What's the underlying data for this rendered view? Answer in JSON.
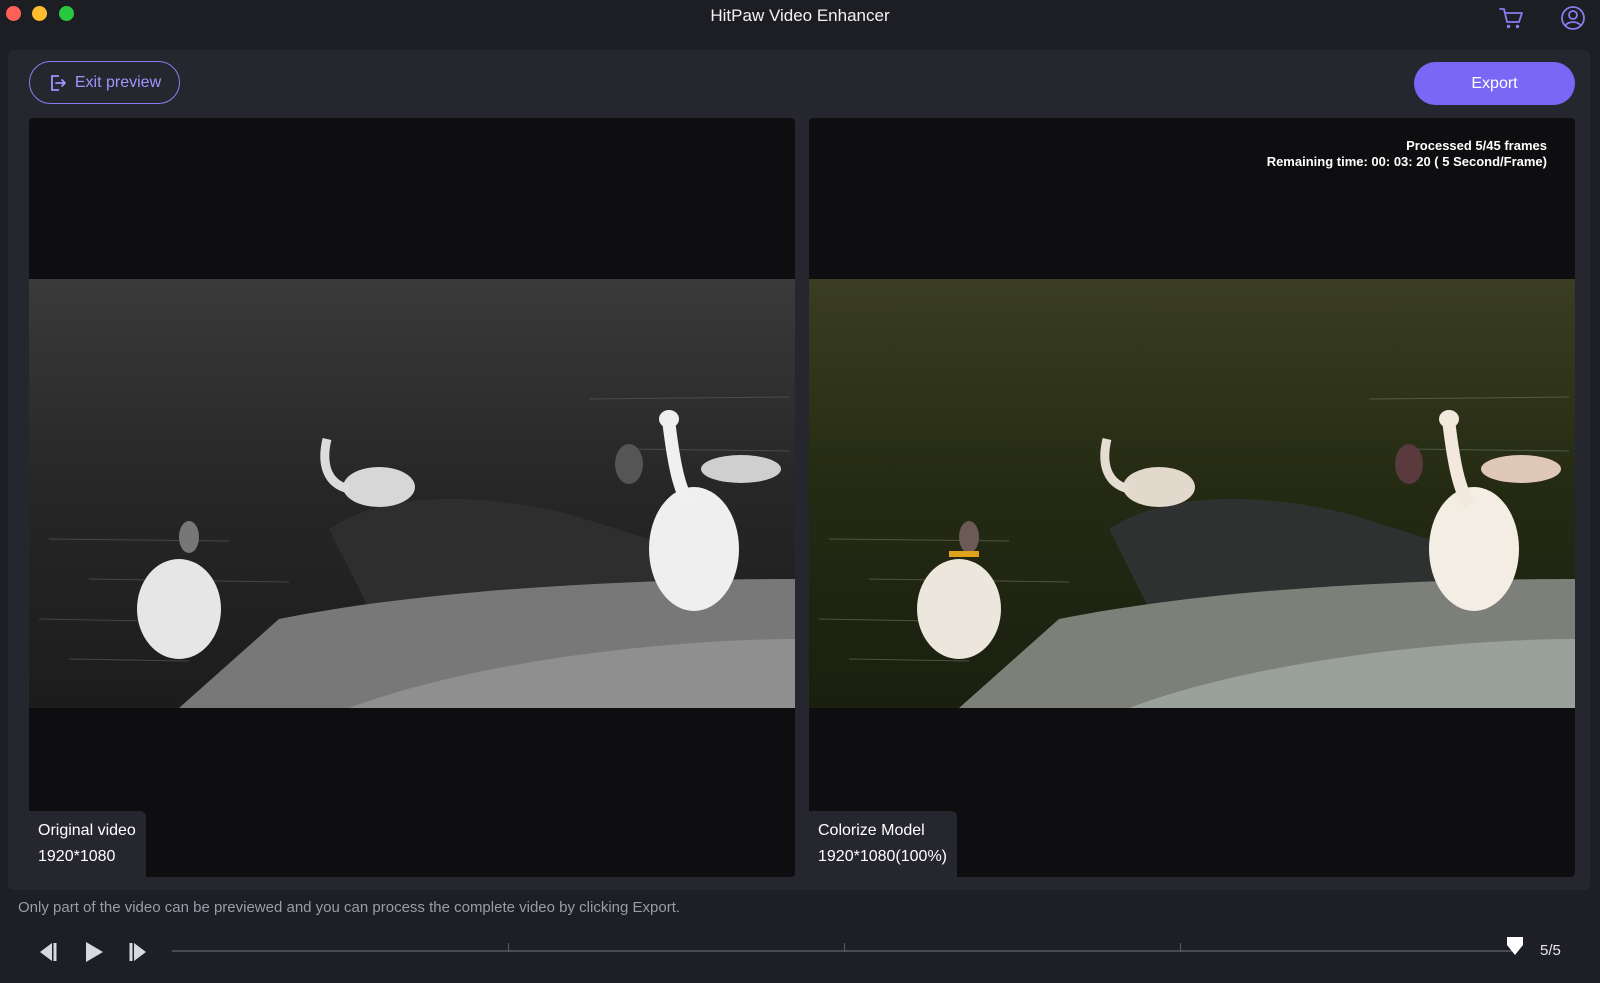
{
  "window": {
    "title": "HitPaw Video Enhancer"
  },
  "toolbar": {
    "exit_preview_label": "Exit preview",
    "export_label": "Export"
  },
  "left_panel": {
    "label": "Original video",
    "resolution": "1920*1080"
  },
  "right_panel": {
    "label": "Colorize Model",
    "resolution": "1920*1080(100%)",
    "progress_text": "Processed 5/45 frames",
    "remaining_text": "Remaining time: 00: 03: 20 ( 5 Second/Frame)"
  },
  "footer": {
    "hint": "Only part of the video can be previewed and you can process the complete video by clicking Export.",
    "frame_counter": "5/5",
    "timeline_position": 1.0
  },
  "colors": {
    "accent": "#7b67f6",
    "background": "#1e1e26",
    "panel": "#0e0e11"
  },
  "icons": {
    "cart": "cart-icon",
    "account": "user-circle-icon",
    "exit": "exit-icon",
    "prev_frame": "step-back-icon",
    "play": "play-icon",
    "next_frame": "step-forward-icon"
  }
}
